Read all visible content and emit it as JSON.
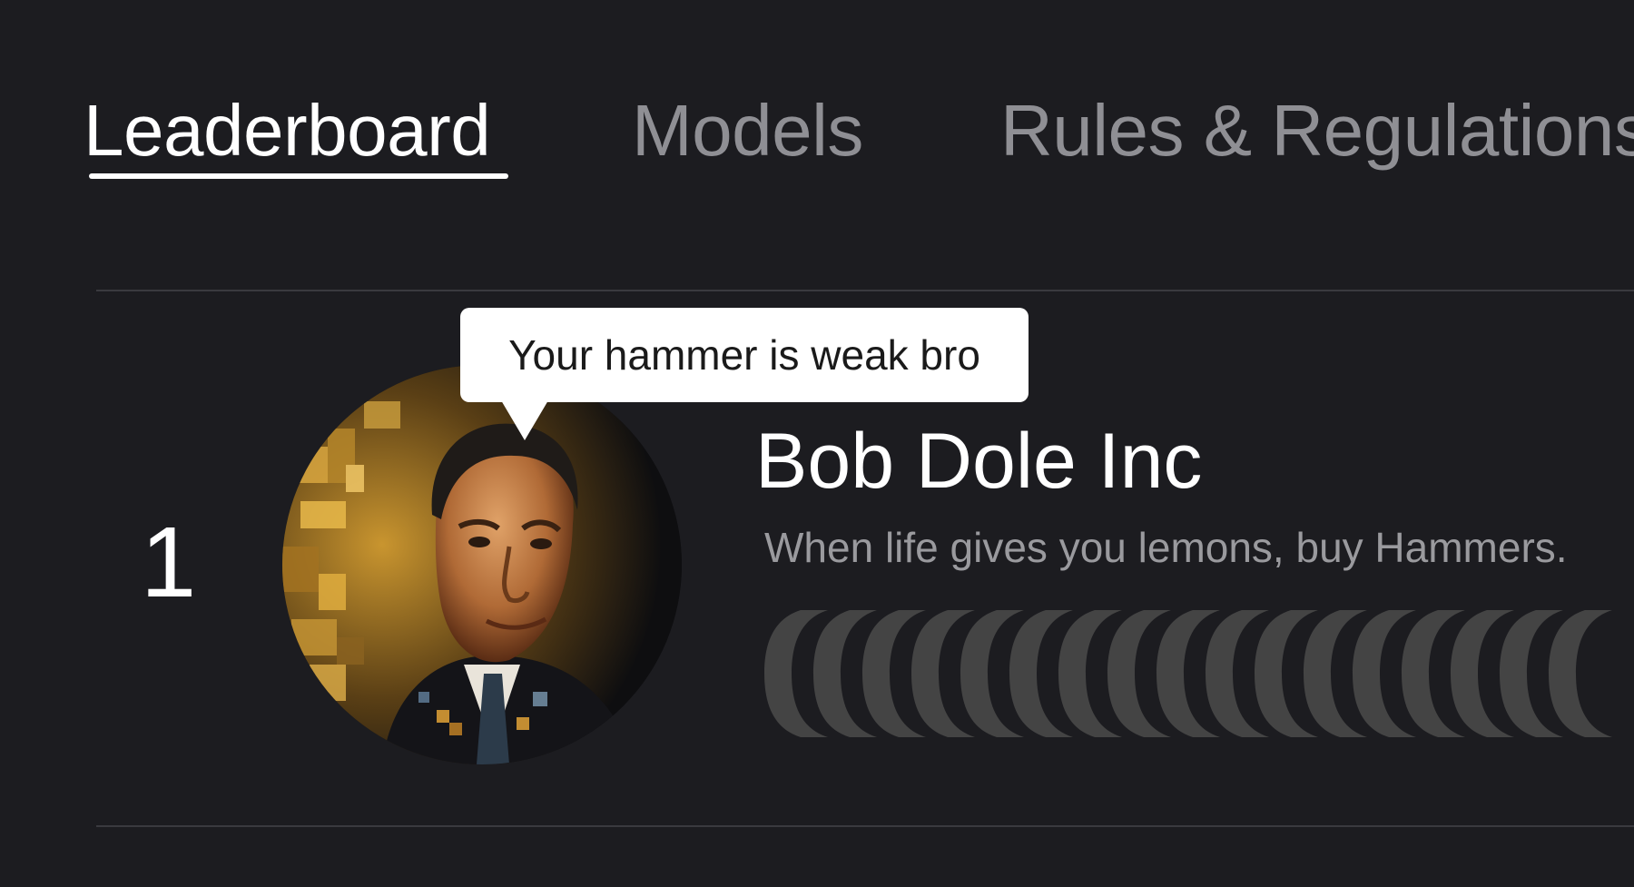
{
  "nav": {
    "tabs": [
      {
        "label": "Leaderboard",
        "active": true
      },
      {
        "label": "Models",
        "active": false
      },
      {
        "label": "Rules & Regulations",
        "active": false
      }
    ]
  },
  "leaderboard": {
    "entries": [
      {
        "rank": "1",
        "name": "Bob Dole Inc",
        "motto": "When life gives you lemons, buy Hammers.",
        "tooltip": "Your hammer is weak bro",
        "avatar_icon": "portrait-avatar"
      }
    ]
  },
  "colors": {
    "background": "#1c1c20",
    "active_text": "#ffffff",
    "inactive_text": "#8f8f94",
    "muted_text": "#9a9a9e",
    "divider": "#3a3a3f",
    "bar_segment": "#444444",
    "tooltip_bg": "#ffffff"
  }
}
